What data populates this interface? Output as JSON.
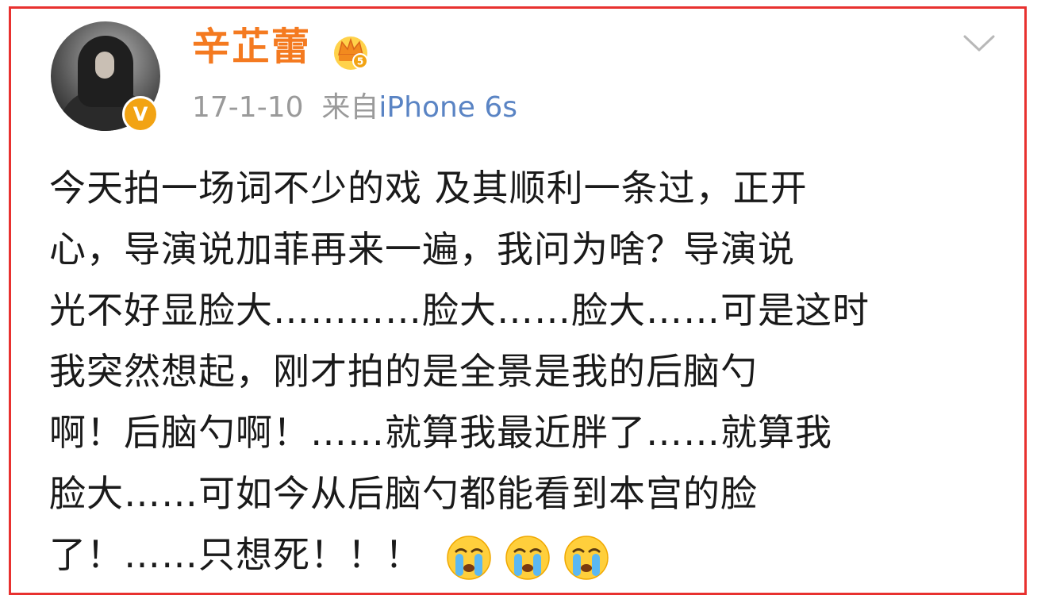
{
  "post": {
    "author": "辛芷蕾",
    "timestamp": "17-1-10",
    "source_prefix": "来自",
    "device": "iPhone 6s",
    "verified_badge": "V",
    "member_level": "5",
    "text_lines": [
      "今天拍一场词不少的戏 及其顺利一条过，正开",
      "心，导演说加菲再来一遍，我问为啥？导演说",
      "光不好显脸大…………脸大……脸大……可是这时",
      "我突然想起，刚才拍的是全景是我的后脑勺",
      "啊！后脑勺啊！……就算我最近胖了……就算我",
      "脸大……可如今从后脑勺都能看到本宫的脸",
      "了！……只想死！！！"
    ],
    "emojis": [
      "crying-face",
      "crying-face",
      "crying-face"
    ]
  },
  "colors": {
    "frame_border": "#e8312f",
    "username": "#f47a20",
    "meta_gray": "#9a9a9a",
    "device_link": "#5a84c4",
    "verified": "#f2a313",
    "body_text": "#1a1a1a"
  }
}
